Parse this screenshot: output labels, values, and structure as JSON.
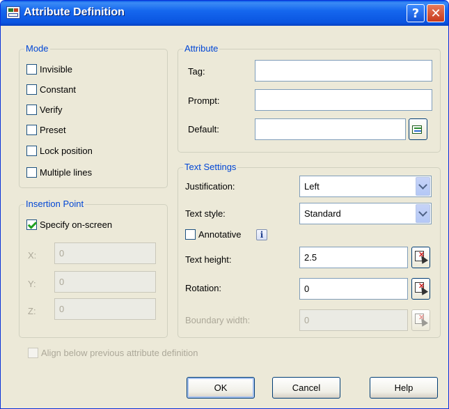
{
  "window": {
    "title": "Attribute Definition"
  },
  "titlebar": {
    "help_glyph": "?",
    "close_glyph": "✕"
  },
  "mode": {
    "legend": "Mode",
    "items": [
      {
        "label": "Invisible",
        "checked": false
      },
      {
        "label": "Constant",
        "checked": false
      },
      {
        "label": "Verify",
        "checked": false
      },
      {
        "label": "Preset",
        "checked": false
      },
      {
        "label": "Lock position",
        "checked": false
      },
      {
        "label": "Multiple lines",
        "checked": false
      }
    ]
  },
  "insertion_point": {
    "legend": "Insertion Point",
    "specify_label": "Specify on-screen",
    "specify_checked": true,
    "x_label": "X:",
    "x_value": "0",
    "y_label": "Y:",
    "y_value": "0",
    "z_label": "Z:",
    "z_value": "0"
  },
  "attribute": {
    "legend": "Attribute",
    "tag_label": "Tag:",
    "tag_value": "",
    "prompt_label": "Prompt:",
    "prompt_value": "",
    "default_label": "Default:",
    "default_value": ""
  },
  "text_settings": {
    "legend": "Text Settings",
    "justification_label": "Justification:",
    "justification_value": "Left",
    "text_style_label": "Text style:",
    "text_style_value": "Standard",
    "annotative_label": "Annotative",
    "annotative_checked": false,
    "info_glyph": "i",
    "text_height_label": "Text height:",
    "text_height_value": "2.5",
    "rotation_label": "Rotation:",
    "rotation_value": "0",
    "boundary_width_label": "Boundary width:",
    "boundary_width_value": "0"
  },
  "align_below": {
    "label": "Align below previous attribute definition",
    "checked": false
  },
  "buttons": {
    "ok": "OK",
    "cancel": "Cancel",
    "help": "Help"
  }
}
